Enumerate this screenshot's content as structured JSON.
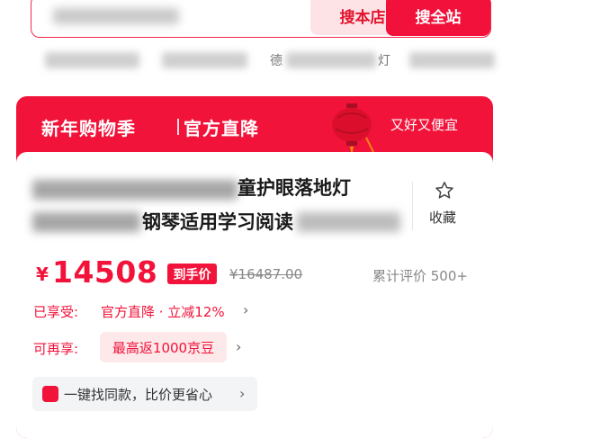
{
  "search": {
    "store_button": "搜本店",
    "all_button": "搜全站"
  },
  "hot_words": [
    "德",
    "灯"
  ],
  "promo": {
    "title": "新年购物季",
    "subtitle": "官方直降",
    "slogan": "又好又便宜"
  },
  "product": {
    "title_line1_visible": "童护眼落地灯",
    "title_line2_visible": "钢琴适用学习阅读",
    "favorite_label": "收藏",
    "price_symbol": "¥",
    "price": "14508",
    "price_tag": "到手价",
    "original_price": "¥16487.00",
    "reviews": "累计评价 500+",
    "enjoyed_label": "已享受:",
    "enjoyed_value": "官方直降 · 立减12%",
    "more_label": "可再享:",
    "more_value": "最高返1000京豆",
    "similar_text": "一键找同款，比价更省心"
  }
}
